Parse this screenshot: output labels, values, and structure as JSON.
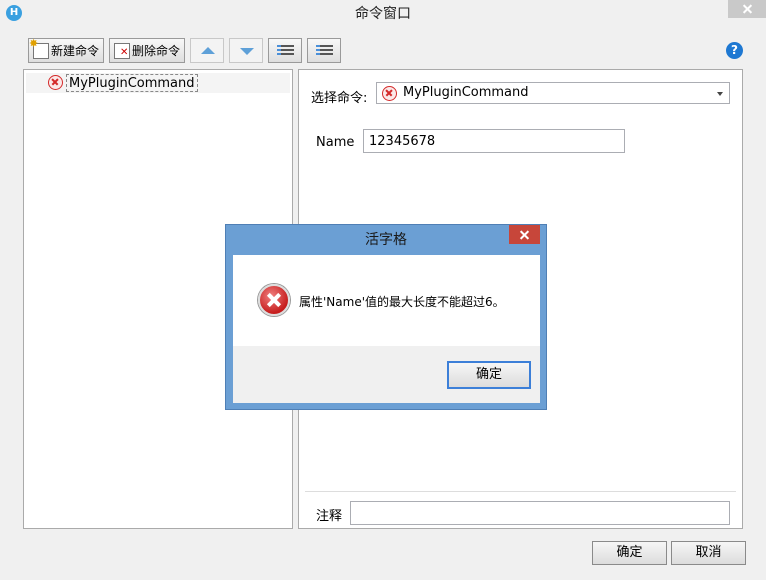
{
  "window": {
    "title": "命令窗口",
    "app_icon": "H"
  },
  "toolbar": {
    "new_command_label": "新建命令",
    "delete_command_label": "删除命令",
    "help_icon_text": "?"
  },
  "tree": {
    "items": [
      {
        "label": "MyPluginCommand",
        "status": "error"
      }
    ]
  },
  "editor": {
    "select_label": "选择命令:",
    "selected_command": "MyPluginCommand",
    "name_label": "Name",
    "name_value": "12345678",
    "note_label": "注释",
    "note_value": ""
  },
  "footer": {
    "ok_label": "确定",
    "cancel_label": "取消"
  },
  "error_dialog": {
    "title": "活字格",
    "message": "属性'Name'值的最大长度不能超过6。",
    "ok_label": "确定"
  },
  "colors": {
    "dialog_frame": "#6b9fd4",
    "error_red": "#d42a2a",
    "close_red": "#c7463a",
    "accent_blue": "#1e78d2"
  }
}
